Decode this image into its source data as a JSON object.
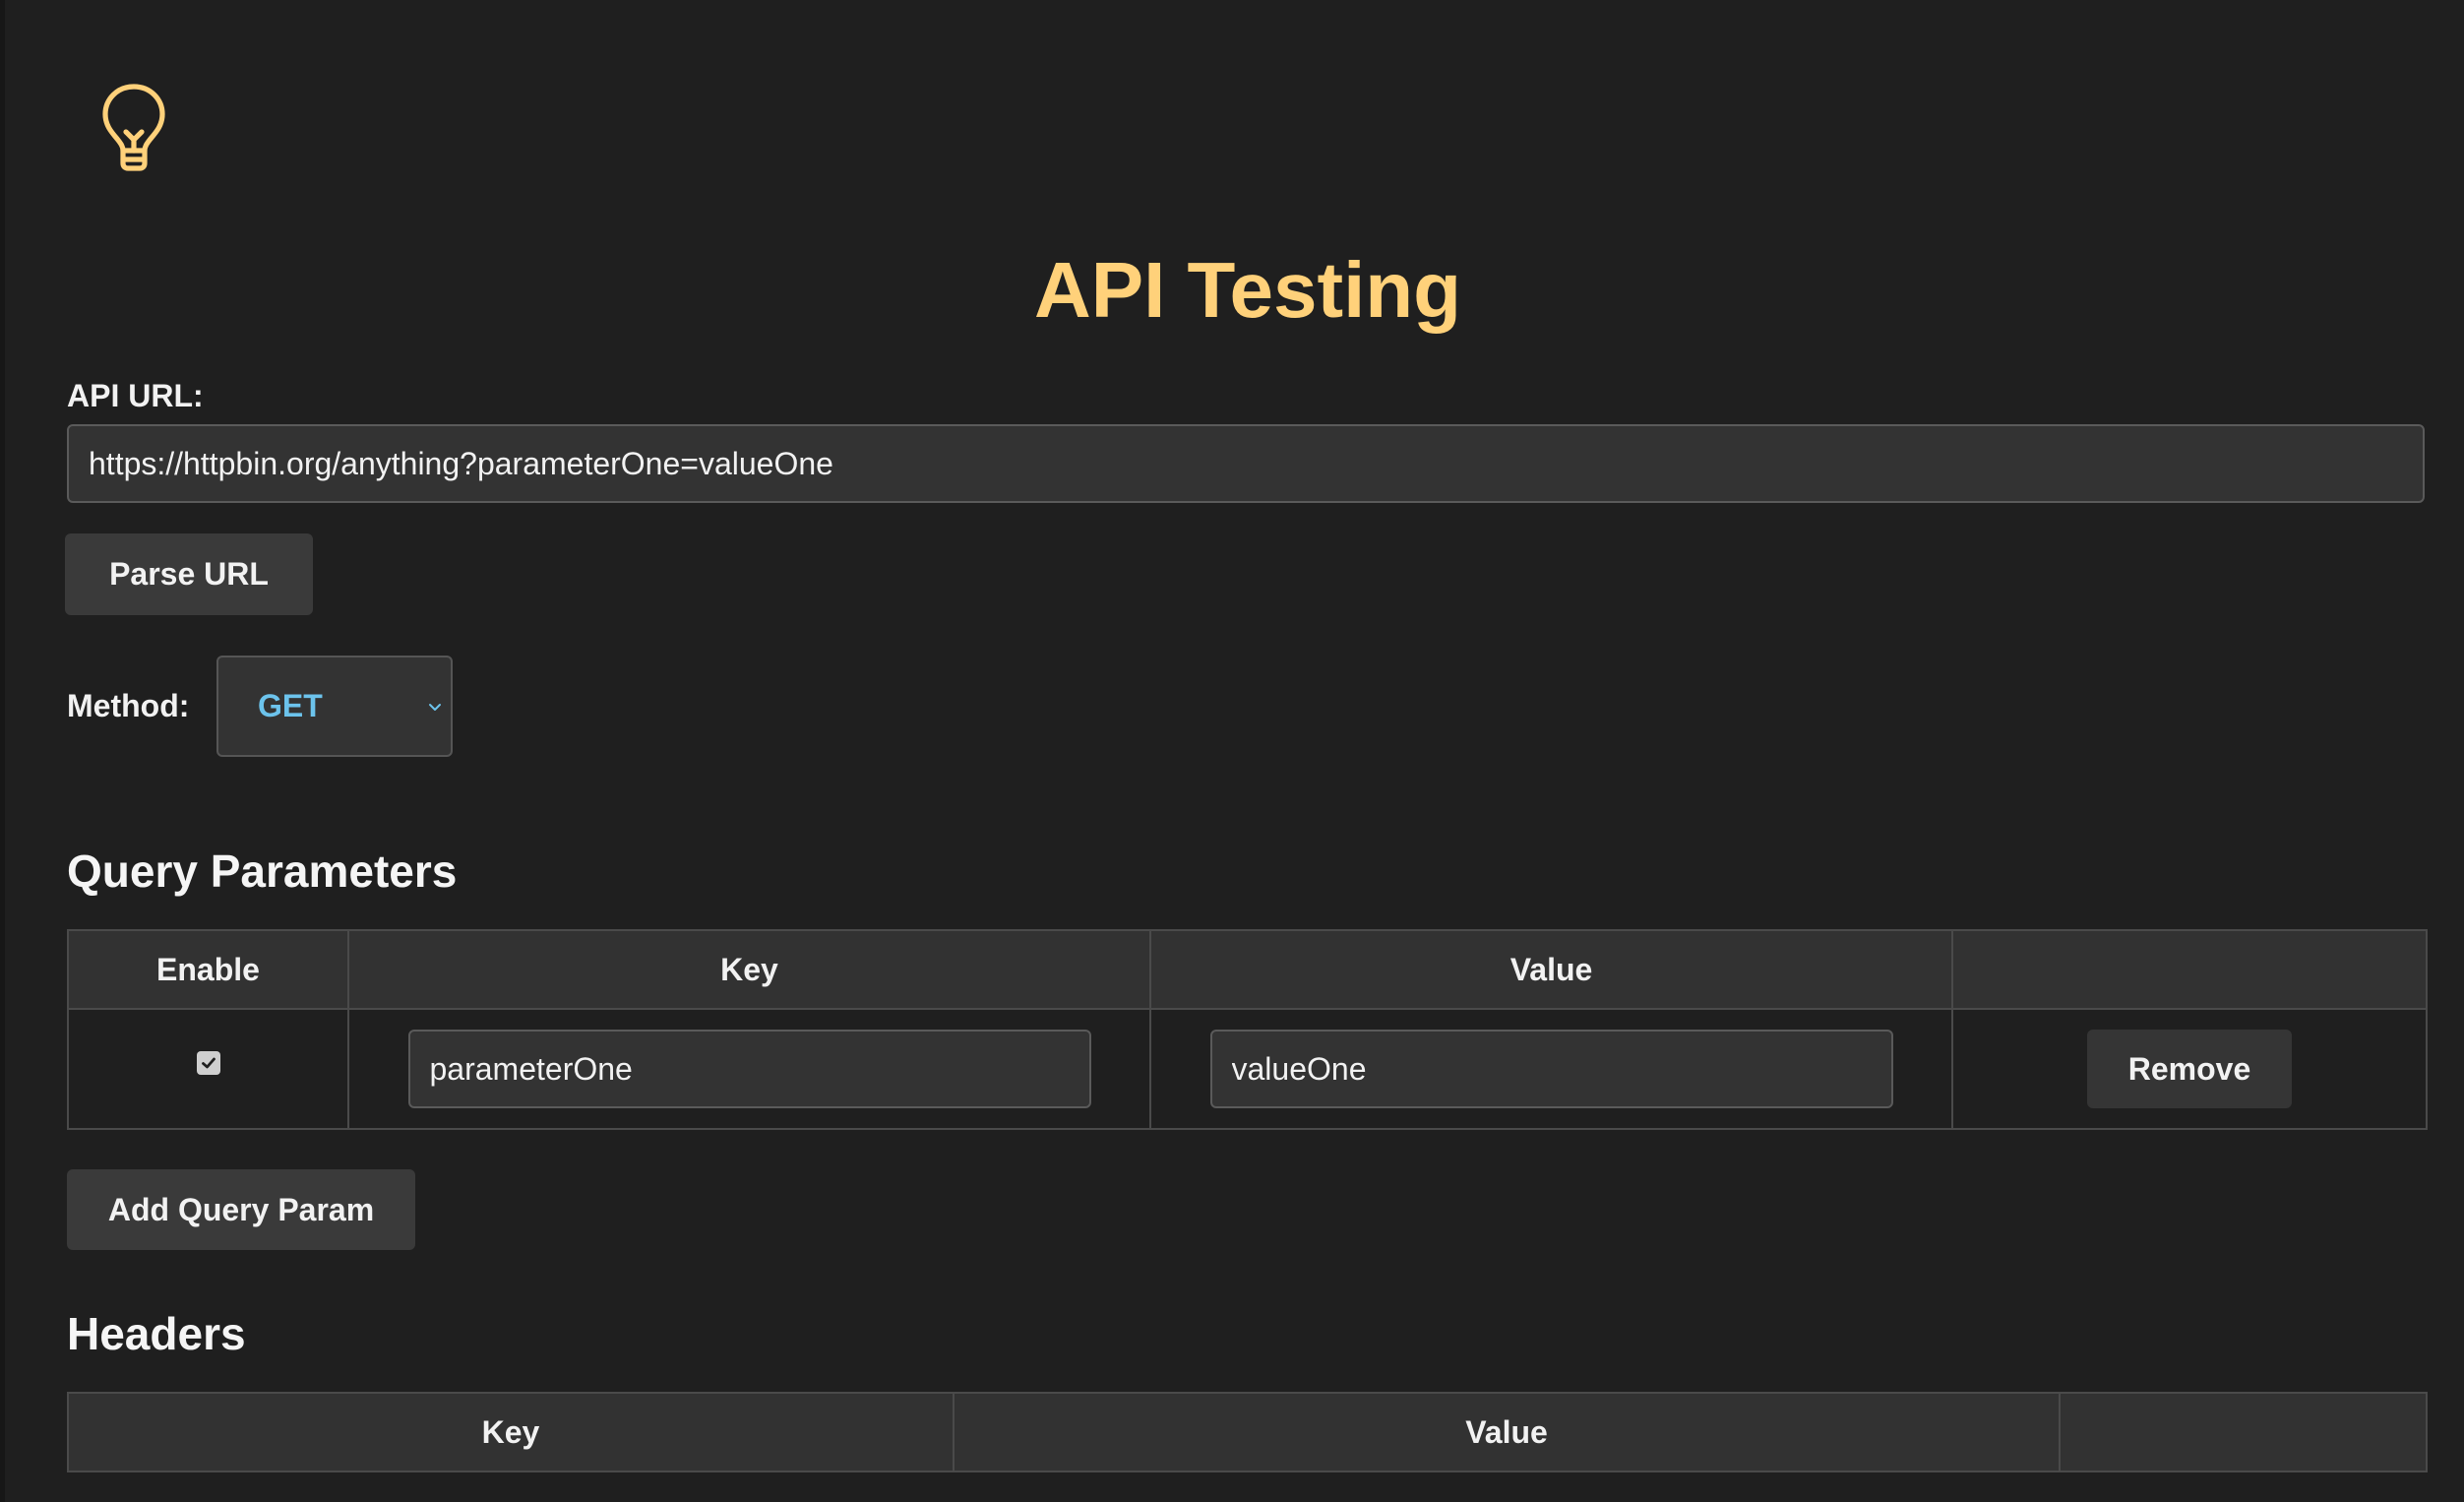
{
  "page": {
    "title": "API Testing",
    "accent_color": "#ffd17a",
    "logo_icon": "lightbulb-icon"
  },
  "request": {
    "url_label": "API URL:",
    "url_value": "https://httpbin.org/anything?parameterOne=valueOne",
    "parse_button": "Parse URL",
    "method_label": "Method:",
    "method_value": "GET",
    "method_color": "#6cc3ec"
  },
  "query_params": {
    "title": "Query Parameters",
    "columns": [
      "Enable",
      "Key",
      "Value",
      ""
    ],
    "rows": [
      {
        "enabled": true,
        "key": "parameterOne",
        "value": "valueOne",
        "remove_label": "Remove"
      }
    ],
    "add_button": "Add Query Param"
  },
  "headers": {
    "title": "Headers",
    "columns": [
      "Key",
      "Value",
      ""
    ]
  }
}
